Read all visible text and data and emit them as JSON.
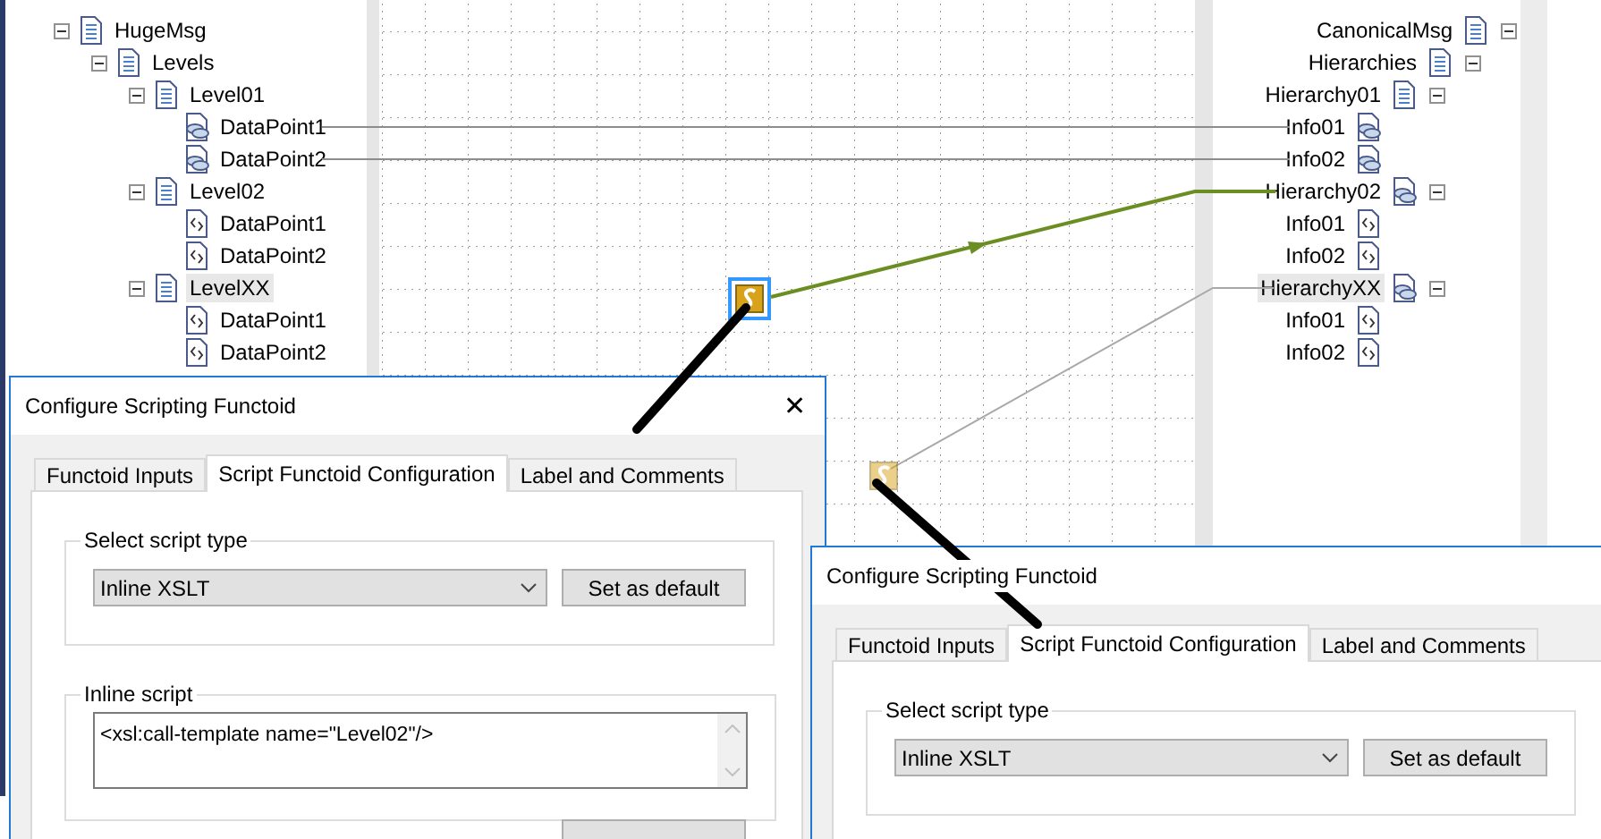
{
  "source_tree": [
    {
      "label": "HugeMsg",
      "kind": "record",
      "expanded": true,
      "selected": false,
      "children": [
        {
          "label": "Levels",
          "kind": "record",
          "expanded": true,
          "selected": false,
          "children": [
            {
              "label": "Level01",
              "kind": "record",
              "expanded": true,
              "selected": false,
              "children": [
                {
                  "label": "DataPoint1",
                  "kind": "linked_field",
                  "selected": false
                },
                {
                  "label": "DataPoint2",
                  "kind": "linked_field",
                  "selected": false
                }
              ]
            },
            {
              "label": "Level02",
              "kind": "record",
              "expanded": true,
              "selected": false,
              "children": [
                {
                  "label": "DataPoint1",
                  "kind": "field",
                  "selected": false
                },
                {
                  "label": "DataPoint2",
                  "kind": "field",
                  "selected": false
                }
              ]
            },
            {
              "label": "LevelXX",
              "kind": "record",
              "expanded": true,
              "selected": true,
              "children": [
                {
                  "label": "DataPoint1",
                  "kind": "field",
                  "selected": false
                },
                {
                  "label": "DataPoint2",
                  "kind": "field",
                  "selected": false
                }
              ]
            }
          ]
        }
      ]
    }
  ],
  "target_tree": [
    {
      "label": "CanonicalMsg",
      "kind": "record",
      "expanded": true,
      "selected": false,
      "children": [
        {
          "label": "Hierarchies",
          "kind": "record",
          "expanded": true,
          "selected": false,
          "children": [
            {
              "label": "Hierarchy01",
              "kind": "record",
              "expanded": true,
              "selected": false,
              "children": [
                {
                  "label": "Info01",
                  "kind": "linked_field",
                  "selected": false
                },
                {
                  "label": "Info02",
                  "kind": "linked_field",
                  "selected": false
                }
              ]
            },
            {
              "label": "Hierarchy02",
              "kind": "linked_record",
              "expanded": true,
              "selected": false,
              "children": [
                {
                  "label": "Info01",
                  "kind": "field",
                  "selected": false
                },
                {
                  "label": "Info02",
                  "kind": "field",
                  "selected": false
                }
              ]
            },
            {
              "label": "HierarchyXX",
              "kind": "linked_record",
              "expanded": true,
              "selected": true,
              "children": [
                {
                  "label": "Info01",
                  "kind": "field",
                  "selected": false
                },
                {
                  "label": "Info02",
                  "kind": "field",
                  "selected": false
                }
              ]
            }
          ]
        }
      ]
    }
  ],
  "functoids": [
    {
      "selected": true
    },
    {
      "selected": false
    }
  ],
  "dialogs": [
    {
      "title": "Configure Scripting Functoid",
      "close": "✕",
      "tabs": [
        {
          "label": "Functoid Inputs",
          "selected": false
        },
        {
          "label": "Script Functoid Configuration",
          "selected": true
        },
        {
          "label": "Label and Comments",
          "selected": false
        }
      ],
      "script_type_group": "Select script type",
      "script_type": "Inline XSLT",
      "default_button": "Set as default",
      "script_group": "Inline script",
      "script": "<xsl:call-template name=\"Level02\"/>"
    },
    {
      "title": "Configure Scripting Functoid",
      "tabs": [
        {
          "label": "Functoid Inputs",
          "selected": false
        },
        {
          "label": "Script Functoid Configuration",
          "selected": true
        },
        {
          "label": "Label and Comments",
          "selected": false
        }
      ],
      "script_type_group": "Select script type",
      "script_type": "Inline XSLT",
      "default_button": "Set as default"
    }
  ]
}
